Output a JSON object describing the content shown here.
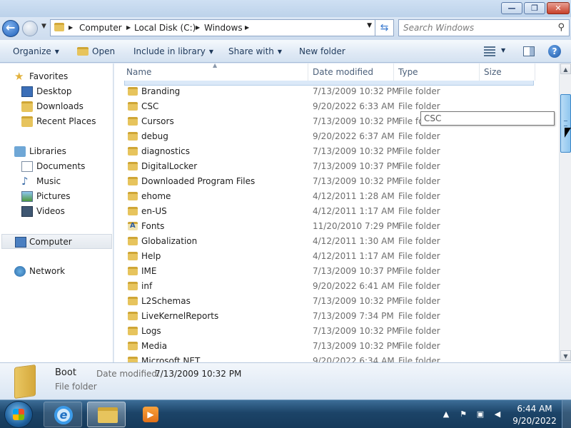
{
  "window": {
    "buttons": {
      "minimize": "—",
      "maximize": "❐",
      "close": "✕"
    }
  },
  "address": {
    "crumbs": [
      "Computer",
      "Local Disk (C:)",
      "Windows"
    ],
    "search_placeholder": "Search Windows"
  },
  "toolbar": {
    "organize": "Organize",
    "open": "Open",
    "include": "Include in library",
    "share": "Share with",
    "newfolder": "New folder"
  },
  "nav": {
    "favorites": "Favorites",
    "desktop": "Desktop",
    "downloads": "Downloads",
    "recent": "Recent Places",
    "libraries": "Libraries",
    "documents": "Documents",
    "music": "Music",
    "pictures": "Pictures",
    "videos": "Videos",
    "computer": "Computer",
    "network": "Network"
  },
  "columns": {
    "name": "Name",
    "date": "Date modified",
    "type": "Type",
    "size": "Size"
  },
  "files": [
    {
      "name": "Branding",
      "date": "7/13/2009 10:32 PM",
      "type": "File folder"
    },
    {
      "name": "CSC",
      "date": "9/20/2022 6:33 AM",
      "type": "File folder"
    },
    {
      "name": "Cursors",
      "date": "7/13/2009 10:32 PM",
      "type": "File folder"
    },
    {
      "name": "debug",
      "date": "9/20/2022 6:37 AM",
      "type": "File folder"
    },
    {
      "name": "diagnostics",
      "date": "7/13/2009 10:32 PM",
      "type": "File folder"
    },
    {
      "name": "DigitalLocker",
      "date": "7/13/2009 10:37 PM",
      "type": "File folder"
    },
    {
      "name": "Downloaded Program Files",
      "date": "7/13/2009 10:32 PM",
      "type": "File folder"
    },
    {
      "name": "ehome",
      "date": "4/12/2011 1:28 AM",
      "type": "File folder"
    },
    {
      "name": "en-US",
      "date": "4/12/2011 1:17 AM",
      "type": "File folder"
    },
    {
      "name": "Fonts",
      "date": "11/20/2010 7:29 PM",
      "type": "File folder"
    },
    {
      "name": "Globalization",
      "date": "4/12/2011 1:30 AM",
      "type": "File folder"
    },
    {
      "name": "Help",
      "date": "4/12/2011 1:17 AM",
      "type": "File folder"
    },
    {
      "name": "IME",
      "date": "7/13/2009 10:37 PM",
      "type": "File folder"
    },
    {
      "name": "inf",
      "date": "9/20/2022 6:41 AM",
      "type": "File folder"
    },
    {
      "name": "L2Schemas",
      "date": "7/13/2009 10:32 PM",
      "type": "File folder"
    },
    {
      "name": "LiveKernelReports",
      "date": "7/13/2009 7:34 PM",
      "type": "File folder"
    },
    {
      "name": "Logs",
      "date": "7/13/2009 10:32 PM",
      "type": "File folder"
    },
    {
      "name": "Media",
      "date": "7/13/2009 10:32 PM",
      "type": "File folder"
    },
    {
      "name": "Microsoft.NET",
      "date": "9/20/2022 6:34 AM",
      "type": "File folder"
    }
  ],
  "tooltip": "CSC",
  "details": {
    "name": "Boot",
    "date_label": "Date modified:",
    "date": "7/13/2009 10:32 PM",
    "type": "File folder"
  },
  "taskbar": {
    "time": "6:44 AM",
    "date": "9/20/2022",
    "ie_glyph": "e",
    "wmp_glyph": "▶"
  },
  "icons": {
    "back": "back-arrow-icon",
    "forward": "forward-arrow-icon",
    "refresh": "refresh-icon",
    "search": "search-icon",
    "help": "help-icon"
  }
}
